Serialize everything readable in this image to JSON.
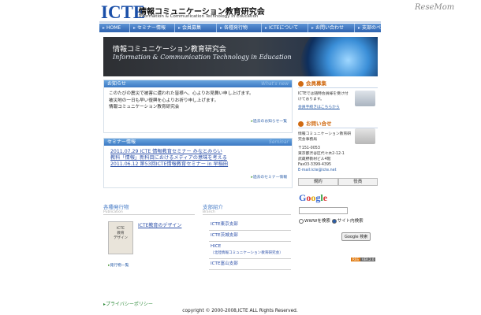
{
  "header": {
    "logo": "ICTE",
    "title": "情報コミュニケーション教育研究会",
    "subtitle": "Information & Communication Technology in Education",
    "watermark": "ReseMom"
  },
  "nav": {
    "items": [
      {
        "label": "HOME"
      },
      {
        "label": "セミナー情報"
      },
      {
        "label": "会員募集"
      },
      {
        "label": "各種発行物"
      },
      {
        "label": "ICTEについて"
      },
      {
        "label": "お問い合わせ"
      },
      {
        "label": "支部のページ"
      }
    ]
  },
  "hero": {
    "title": "情報コミュニケーション教育研究会",
    "subtitle": "Information & Communication Technology in Education"
  },
  "news": {
    "heading": "お知らせ",
    "ghost": "What's new",
    "lines": [
      "このたびの震災で被害に遭われた皆様へ、心よりお見舞い申し上げます。",
      "被災地の一日も早い復興を心よりお祈り申し上げます。",
      "情報コミュニケーション教育研究会"
    ],
    "more": "過去のお知らせ一覧"
  },
  "seminar": {
    "heading": "セミナー情報",
    "ghost": "Seminar",
    "items": [
      {
        "text": "2011.07.29 ICTE 情報教育セミナー みなとみらい"
      },
      {
        "text": "教科「情報」新科目におけるメディアの意味を考える"
      },
      {
        "text": "2011.06.12 第53回ICTE情報教育セミナー in 早稲田"
      }
    ],
    "more": "過去のセミナー情報"
  },
  "publications": {
    "heading": "各種発行物",
    "en": "Publication",
    "book_title_lines": [
      "ICTE",
      "教育",
      "デザイン"
    ],
    "link": "ICTE教育のデザイン",
    "more": "発行物一覧"
  },
  "branches": {
    "heading": "支部紹介",
    "en": "Branch",
    "items": [
      {
        "label": "ICTE東京支部"
      },
      {
        "label": "ICTE茨城支部"
      },
      {
        "label": "HICE"
      },
      {
        "label": "（北陸情報コミュニケーション教育研究会）"
      },
      {
        "label": "ICTE富山支部"
      }
    ]
  },
  "sidebar": {
    "member": {
      "heading": "会員募集",
      "text": "ICTEでは随時会員様を受け付けております。",
      "link": "会員手続きはこちらから"
    },
    "contact": {
      "heading": "お問い合せ",
      "org": "情報コミュニケーション教育研究会事務局",
      "postal": "〒151-0053",
      "address": "東京都渋谷区代々木2-12-1",
      "building": "武蔵野教材ビル4階",
      "fax": "Fax03-3399-4395",
      "email": "E-mail:icte@icte.net"
    },
    "tabs": [
      {
        "label": "規約"
      },
      {
        "label": "役員"
      }
    ]
  },
  "google": {
    "logo": "Google",
    "radio_www": "WWWを検索",
    "radio_site": "サイト内検索",
    "button": "Google 検索",
    "rss": "RSS",
    "ver": "VER.2.0"
  },
  "footer": {
    "privacy": "プライバシーポリシー",
    "copyright": "copyright © 2000-2008,ICTE ALL Rights Reserved."
  },
  "colors": {
    "nav": "#2e63b0",
    "accent": "#d06a12",
    "link": "#2b4fa8"
  }
}
